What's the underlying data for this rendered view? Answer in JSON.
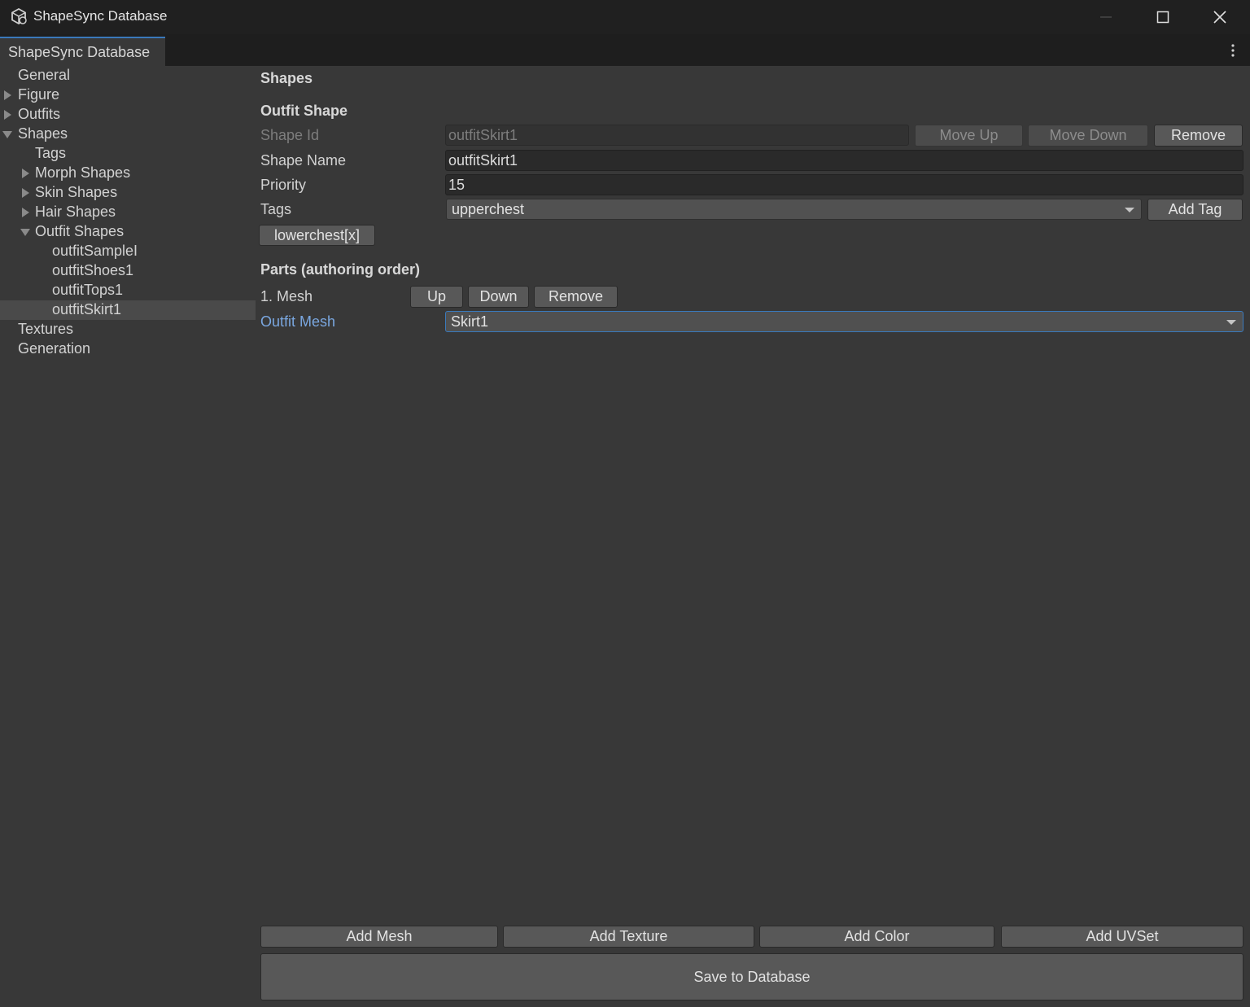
{
  "window": {
    "title": "ShapeSync Database"
  },
  "tab": {
    "label": "ShapeSync Database"
  },
  "tree": {
    "items": [
      {
        "label": "General"
      },
      {
        "label": "Figure"
      },
      {
        "label": "Outfits"
      },
      {
        "label": "Shapes"
      },
      {
        "label": "Tags"
      },
      {
        "label": "Morph Shapes"
      },
      {
        "label": "Skin Shapes"
      },
      {
        "label": "Hair Shapes"
      },
      {
        "label": "Outfit Shapes"
      },
      {
        "label": "outfitSampleI"
      },
      {
        "label": "outfitShoes1"
      },
      {
        "label": "outfitTops1"
      },
      {
        "label": "outfitSkirt1"
      },
      {
        "label": "Textures"
      },
      {
        "label": "Generation"
      }
    ],
    "selected": "outfitSkirt1"
  },
  "main": {
    "section_title": "Shapes",
    "subsection_title": "Outfit Shape",
    "shape_id": {
      "label": "Shape Id",
      "value": "outfitSkirt1"
    },
    "move_up": "Move Up",
    "move_down": "Move Down",
    "remove": "Remove",
    "shape_name": {
      "label": "Shape Name",
      "value": "outfitSkirt1"
    },
    "priority": {
      "label": "Priority",
      "value": "15"
    },
    "tags": {
      "label": "Tags",
      "selected": "upperchest",
      "add_label": "Add Tag",
      "chips": [
        "lowerchest[x]"
      ]
    },
    "parts_title": "Parts (authoring order)",
    "part": {
      "label": "1. Mesh",
      "up": "Up",
      "down": "Down",
      "remove": "Remove",
      "mesh_label": "Outfit Mesh",
      "mesh_value": "Skirt1"
    },
    "bottom": {
      "add_mesh": "Add Mesh",
      "add_texture": "Add Texture",
      "add_color": "Add Color",
      "add_uvset": "Add UVSet",
      "save": "Save to Database"
    }
  },
  "colors": {
    "accent": "#3a79bb",
    "panel": "#383838",
    "titlebar": "#202020"
  }
}
